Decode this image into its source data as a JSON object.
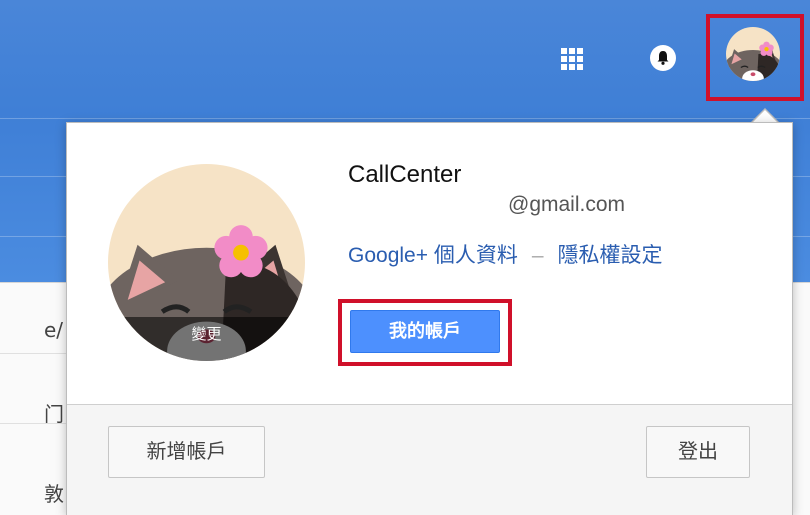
{
  "header": {
    "apps_icon": "apps-grid-icon",
    "notifications_icon": "bell-icon",
    "avatar_icon": "cat-avatar"
  },
  "background": {
    "fragment_1": "e/",
    "fragment_2": "门",
    "fragment_3": "敦"
  },
  "account_popup": {
    "name": "CallCenter",
    "email": "@gmail.com",
    "change_photo_label": "變更",
    "profile_link": "Google+ 個人資料",
    "separator": "–",
    "privacy_link": "隱私權設定",
    "my_account_button": "我的帳戶",
    "add_account_button": "新增帳戶",
    "sign_out_button": "登出"
  },
  "colors": {
    "header_blue": "#4a86d8",
    "highlight_red": "#d0102a",
    "primary_button": "#4d90fe",
    "link_blue": "#2a5db0"
  }
}
